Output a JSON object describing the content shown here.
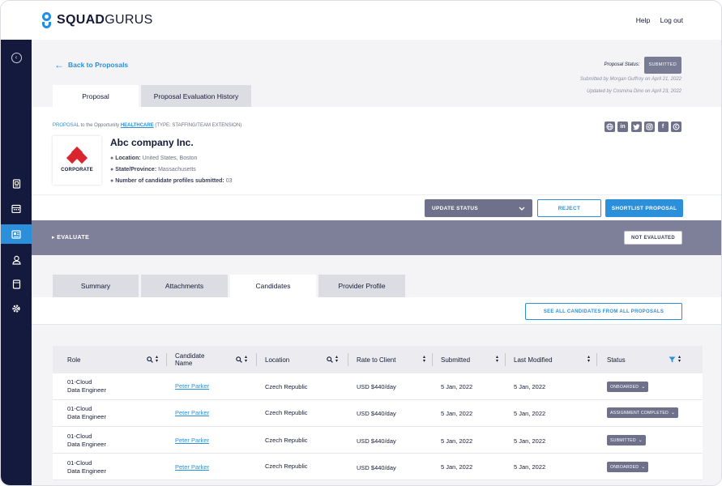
{
  "brand": {
    "name_bold": "SQUAD",
    "name_rest": "GURUS",
    "accent": "#1f8fe6"
  },
  "header": {
    "help": "Help",
    "logout": "Log out"
  },
  "sidebar": {
    "items": [
      {
        "name": "collapse-icon"
      },
      {
        "name": "document-icon"
      },
      {
        "name": "calendar-icon"
      },
      {
        "name": "proposals-icon",
        "active": true
      },
      {
        "name": "user-icon"
      },
      {
        "name": "archive-icon"
      },
      {
        "name": "settings-icon"
      }
    ],
    "bg": "#141a3d",
    "active_color": "#2b8fd9"
  },
  "back_link": "Back to Proposals",
  "proposal_status": {
    "label": "Proposal Status:",
    "value": "SUBMITTED",
    "submitted_by": "Submitted by Morgan Guffroy on April 21, 2022",
    "updated_by": "Updated by Cosmina Dino on April 23, 2022"
  },
  "top_tabs": [
    "Proposal",
    "Proposal Evaluation History"
  ],
  "proposal_line": {
    "prefix": "PROPOSAL",
    "middle": " to the Opportunity ",
    "opportunity": "HEALTHCARE",
    "suffix": " (TYPE: STAFFING/TEAM EXTENSION)"
  },
  "social_icons": [
    "globe-icon",
    "linkedin-icon",
    "twitter-icon",
    "instagram-icon",
    "facebook-icon",
    "crunchbase-icon"
  ],
  "company": {
    "logo_text": "CORPORATE",
    "name": "Abc company Inc.",
    "location_label": "Location:",
    "location": " United States, Boston",
    "state_label": "State/Province:",
    "state": " Massachusetts",
    "profiles_label": "Number of candidate profiles submitted:",
    "profiles": " 03"
  },
  "actions": {
    "update_status": "UPDATE STATUS",
    "reject": "REJECT",
    "shortlist": "SHORTLIST PROPOSAL"
  },
  "evaluate": {
    "label": "EVALUATE",
    "status": "NOT EVALUATED"
  },
  "mid_tabs": [
    "Summary",
    "Attachments",
    "Candidates",
    "Provider Profile"
  ],
  "active_mid_tab": 2,
  "see_all": "SEE ALL CANDIDATES FROM ALL PROPOSALS",
  "table": {
    "headers": {
      "role": "Role",
      "candidate_1": "Candidate",
      "candidate_2": "Name",
      "location": "Location",
      "rate": "Rate to Client",
      "submitted": "Submitted",
      "modified": "Last Modified",
      "status": "Status"
    },
    "rows": [
      {
        "role_1": "01-Cloud",
        "role_2": "Data Engineer",
        "candidate": "Peter Parker",
        "location": "Czech Republic",
        "rate": "USD $440/day",
        "submitted": "5 Jan, 2022",
        "modified": "5 Jan, 2022",
        "status": "ONBOARDED"
      },
      {
        "role_1": "01-Cloud",
        "role_2": "Data Engineer",
        "candidate": "Peter Parker",
        "location": "Czech Republic",
        "rate": "USD $440/day",
        "submitted": "5 Jan, 2022",
        "modified": "5 Jan, 2022",
        "status": "ASSIGNMENT COMPLETED"
      },
      {
        "role_1": "01-Cloud",
        "role_2": "Data Engineer",
        "candidate": "Peter Parker",
        "location": "Czech Republic",
        "rate": "USD $440/day",
        "submitted": "5 Jan, 2022",
        "modified": "5 Jan, 2022",
        "status": "SUBMITTED"
      },
      {
        "role_1": "01-Cloud",
        "role_2": "Data Engineer",
        "candidate": "Peter Parker",
        "location": "Czech Republic",
        "rate": "USD $440/day",
        "submitted": "5 Jan, 2022",
        "modified": "5 Jan, 2022",
        "status": "ONBOARDED"
      }
    ]
  }
}
